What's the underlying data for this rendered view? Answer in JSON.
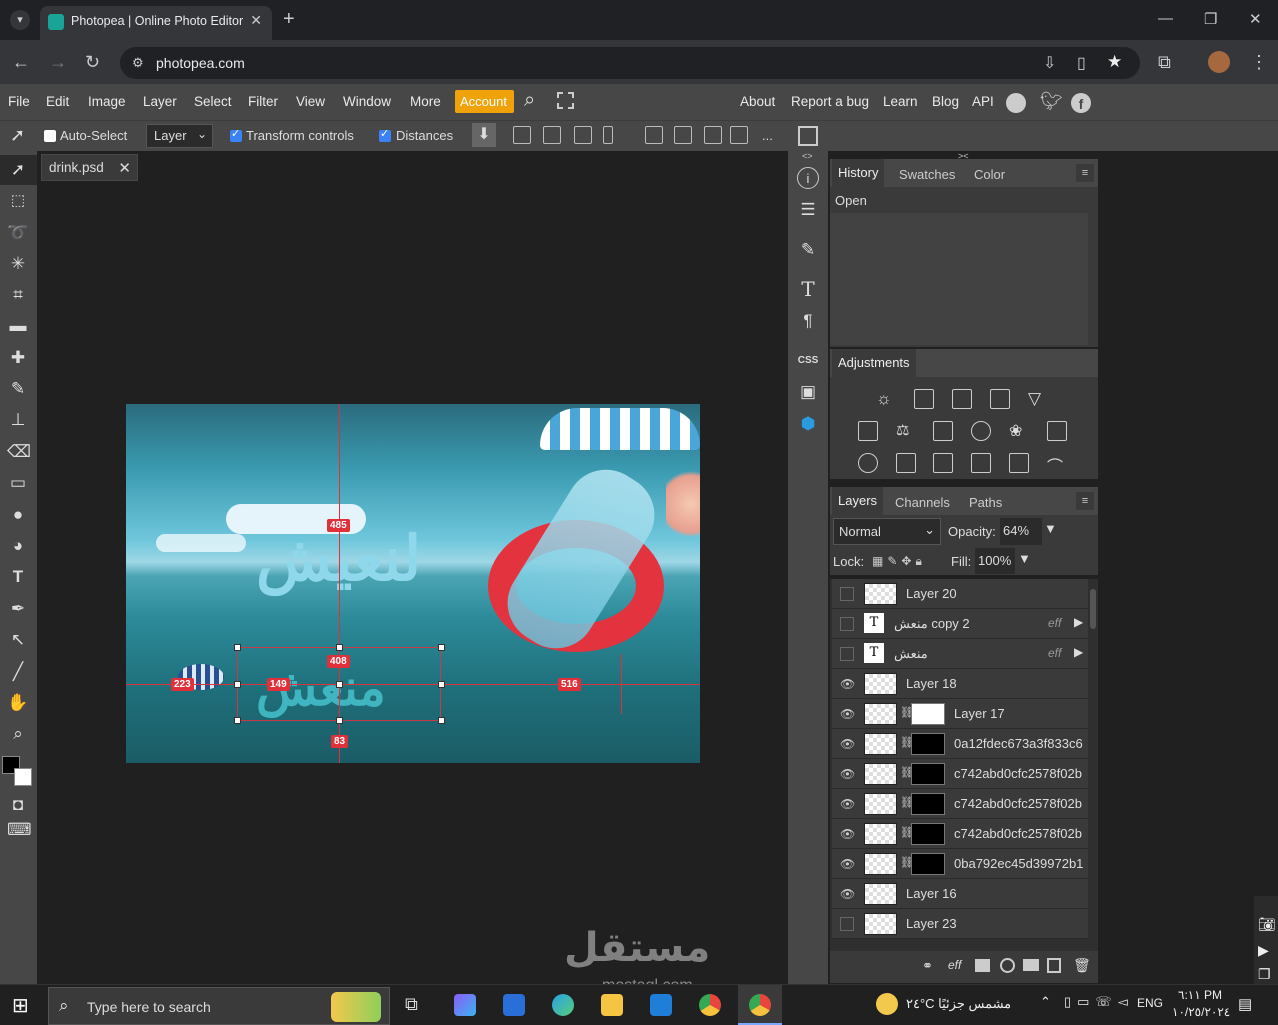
{
  "browser": {
    "tab_title": "Photopea | Online Photo Editor",
    "url": "photopea.com"
  },
  "menu": {
    "items": [
      "File",
      "Edit",
      "Image",
      "Layer",
      "Select",
      "Filter",
      "View",
      "Window",
      "More"
    ],
    "account": "Account",
    "right_items": [
      "About",
      "Report a bug",
      "Learn",
      "Blog",
      "API"
    ]
  },
  "options": {
    "auto_select": "Auto-Select",
    "auto_select_checked": false,
    "layer_dropdown": "Layer",
    "transform_controls": "Transform controls",
    "transform_checked": true,
    "distances": "Distances",
    "distances_checked": true,
    "more": "..."
  },
  "document": {
    "tab_name": "drink.psd",
    "measurements": [
      "485",
      "408",
      "223",
      "149",
      "516",
      "83"
    ]
  },
  "history_panel": {
    "tabs": [
      "History",
      "Swatches",
      "Color"
    ],
    "items": [
      "Open"
    ]
  },
  "adjustments_panel": {
    "title": "Adjustments"
  },
  "layers_panel": {
    "tabs": [
      "Layers",
      "Channels",
      "Paths"
    ],
    "blend_mode": "Normal",
    "opacity_label": "Opacity:",
    "opacity_value": "64%",
    "lock_label": "Lock:",
    "fill_label": "Fill:",
    "fill_value": "100%",
    "layers": [
      {
        "name": "Layer 20",
        "visible": false
      },
      {
        "name": "منعش copy 2",
        "visible": false,
        "type": "text",
        "eff": "eff"
      },
      {
        "name": "منعش",
        "visible": false,
        "type": "text",
        "eff": "eff"
      },
      {
        "name": "Layer 18",
        "visible": true
      },
      {
        "name": "Layer 17",
        "visible": true,
        "mask": "white"
      },
      {
        "name": "0a12fdec673a3f833c6",
        "visible": true,
        "mask": "black"
      },
      {
        "name": "c742abd0cfc2578f02b",
        "visible": true,
        "mask": "black"
      },
      {
        "name": "c742abd0cfc2578f02b",
        "visible": true,
        "mask": "black"
      },
      {
        "name": "c742abd0cfc2578f02b",
        "visible": true,
        "mask": "black"
      },
      {
        "name": "0ba792ec45d39972b1",
        "visible": true,
        "mask": "black"
      },
      {
        "name": "Layer 16",
        "visible": true
      },
      {
        "name": "Layer 23",
        "visible": false
      }
    ]
  },
  "taskbar": {
    "search_placeholder": "Type here to search",
    "weather": "٢٤°C  مشمس جزئيًا",
    "language": "ENG",
    "time": "٦:١١ PM",
    "date": "١٠/٢٥/٢٠٢٤"
  },
  "watermark": {
    "arabic": "مستقل",
    "latin": "mostaql.com"
  }
}
